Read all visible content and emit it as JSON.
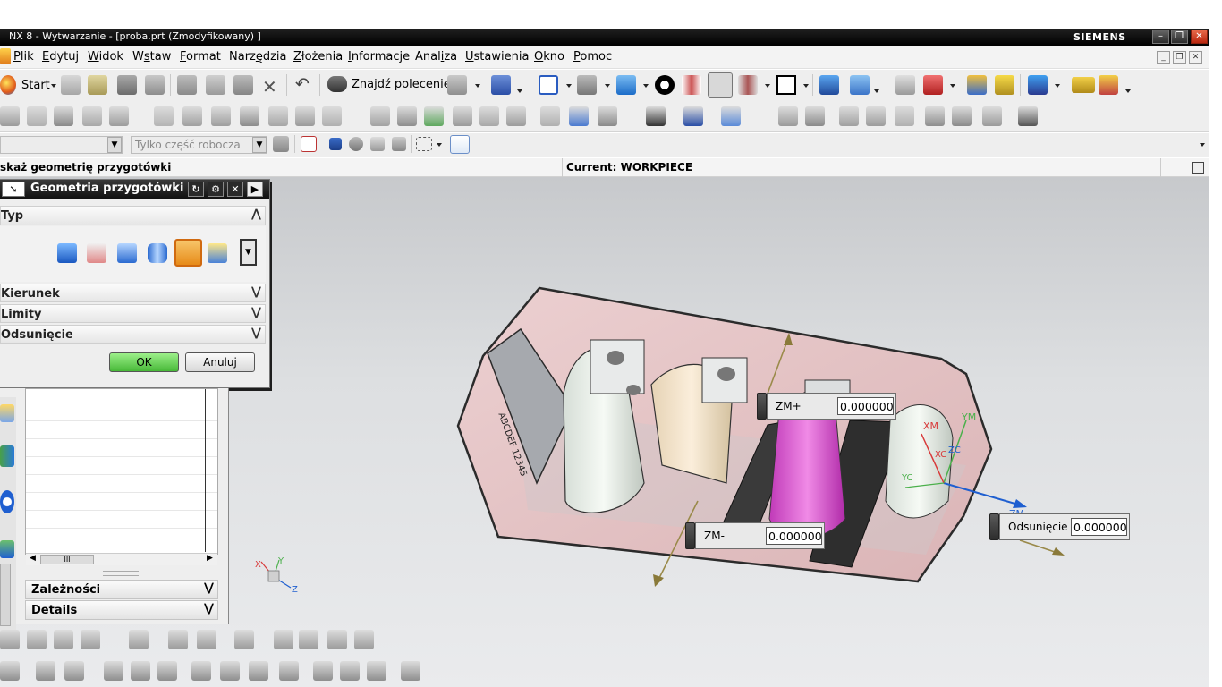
{
  "window": {
    "title": "NX 8 - Wytwarzanie - [proba.prt (Zmodyfikowany) ]",
    "brand": "SIEMENS",
    "btn_min": "–",
    "btn_max": "❐",
    "btn_close": "✕"
  },
  "menu": {
    "items": [
      {
        "pre": "",
        "u": "P",
        "post": "lik"
      },
      {
        "pre": "",
        "u": "E",
        "post": "dytuj"
      },
      {
        "pre": "",
        "u": "W",
        "post": "idok"
      },
      {
        "pre": "W",
        "u": "s",
        "post": "taw"
      },
      {
        "pre": "",
        "u": "F",
        "post": "ormat"
      },
      {
        "pre": "Narz",
        "u": "ę",
        "post": "dzia"
      },
      {
        "pre": "",
        "u": "Z",
        "post": "łożenia"
      },
      {
        "pre": "",
        "u": "I",
        "post": "nformacje"
      },
      {
        "pre": "Anal",
        "u": "i",
        "post": "za"
      },
      {
        "pre": "",
        "u": "U",
        "post": "stawienia"
      },
      {
        "pre": "",
        "u": "O",
        "post": "kno"
      },
      {
        "pre": "",
        "u": "P",
        "post": "omoc"
      }
    ],
    "mdi_min": "_",
    "mdi_restore": "❐",
    "mdi_close": "✕"
  },
  "toolbar": {
    "start_label": "Start",
    "find_command_label": "Znajdź polecenie",
    "filter_placeholder": "Tylko część robocza"
  },
  "status": {
    "prompt": "skaż geometrię przygotówki",
    "current": "Current: WORKPIECE"
  },
  "dialog": {
    "title": "Geometria przygotówki",
    "type_section": "Typ",
    "sections": [
      "Kierunek",
      "Limity",
      "Odsunięcie"
    ],
    "ok": "OK",
    "cancel": "Anuluj"
  },
  "navigator": {
    "scroll_thumb": "III",
    "sections": [
      "Zależności",
      "Details"
    ]
  },
  "handles": {
    "zm_plus_label": "ZM+",
    "zm_plus_value": "0.000000",
    "zm_minus_label": "ZM-",
    "zm_minus_value": "0.000000",
    "offset_label": "Odsunięcie",
    "offset_value": "0.000000"
  },
  "triad": {
    "x": "X",
    "y": "Y",
    "z": "Z"
  },
  "csys": {
    "xm": "XM",
    "ym": "YM",
    "zm": "ZM",
    "xc": "XC",
    "yc": "YC",
    "zc": "ZC"
  },
  "part_text": "ABCDEF 12345",
  "colors": {
    "part_pink": "#e7c3c4",
    "ok_green": "#5fcf4a",
    "accent_blue": "#1f5fd0"
  }
}
